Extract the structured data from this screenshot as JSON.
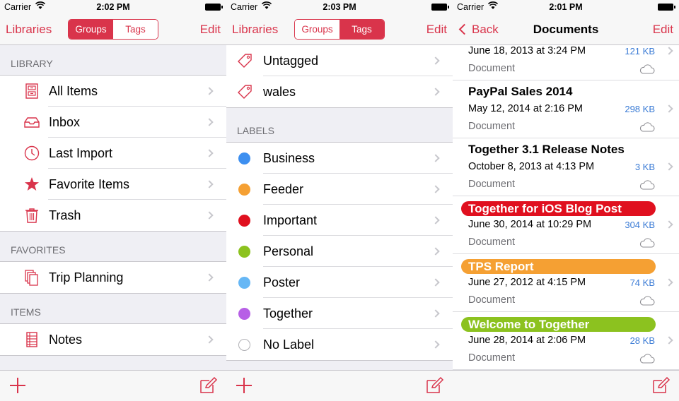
{
  "status_bars": [
    {
      "carrier": "Carrier",
      "time": "2:02 PM"
    },
    {
      "carrier": "Carrier",
      "time": "2:03 PM"
    },
    {
      "carrier": "Carrier",
      "time": "2:01 PM"
    }
  ],
  "panel1": {
    "nav_left": "Libraries",
    "segment": [
      "Groups",
      "Tags"
    ],
    "segment_active": "Groups",
    "nav_right": "Edit",
    "sections": [
      {
        "header": "LIBRARY",
        "items": [
          {
            "label": "All Items",
            "icon": "cabinet-icon"
          },
          {
            "label": "Inbox",
            "icon": "inbox-icon"
          },
          {
            "label": "Last Import",
            "icon": "clock-icon"
          },
          {
            "label": "Favorite Items",
            "icon": "star-icon"
          },
          {
            "label": "Trash",
            "icon": "trash-icon"
          }
        ]
      },
      {
        "header": "FAVORITES",
        "items": [
          {
            "label": "Trip Planning",
            "icon": "documents-icon"
          }
        ]
      },
      {
        "header": "ITEMS",
        "items": [
          {
            "label": "Notes",
            "icon": "notes-icon"
          }
        ]
      }
    ]
  },
  "panel2": {
    "nav_left": "Libraries",
    "segment": [
      "Groups",
      "Tags"
    ],
    "segment_active": "Tags",
    "nav_right": "Edit",
    "tags": [
      {
        "label": "Untagged",
        "icon": "tag-icon"
      },
      {
        "label": "wales",
        "icon": "tag-icon"
      }
    ],
    "labels_header": "LABELS",
    "labels": [
      {
        "label": "Business",
        "color": "#3d8ff0"
      },
      {
        "label": "Feeder",
        "color": "#f5a033"
      },
      {
        "label": "Important",
        "color": "#e0101f"
      },
      {
        "label": "Personal",
        "color": "#8cc21f"
      },
      {
        "label": "Poster",
        "color": "#66b7f5"
      },
      {
        "label": "Together",
        "color": "#b760e6"
      },
      {
        "label": "No Label",
        "color": "#ffffff"
      }
    ]
  },
  "panel3": {
    "nav_left": "Back",
    "title": "Documents",
    "nav_right": "Edit",
    "documents": [
      {
        "title": "",
        "date": "June 18, 2013 at 3:24 PM",
        "size": "121 KB",
        "kind": "Document",
        "label_color": ""
      },
      {
        "title": "PayPal Sales 2014",
        "date": "May 12, 2014 at 2:16 PM",
        "size": "298 KB",
        "kind": "Document",
        "label_color": ""
      },
      {
        "title": "Together 3.1 Release Notes",
        "date": "October 8, 2013 at 4:13 PM",
        "size": "3 KB",
        "kind": "Document",
        "label_color": ""
      },
      {
        "title": "Together for iOS Blog Post",
        "date": "June 30, 2014 at 10:29 PM",
        "size": "304 KB",
        "kind": "Document",
        "label_color": "#e0101f"
      },
      {
        "title": "TPS Report",
        "date": "June 27, 2012 at 4:15 PM",
        "size": "74 KB",
        "kind": "Document",
        "label_color": "#f5a033"
      },
      {
        "title": "Welcome to Together",
        "date": "June 28, 2014 at 2:06 PM",
        "size": "28 KB",
        "kind": "Document",
        "label_color": "#8cc21f"
      }
    ]
  },
  "accent_color": "#d9344b"
}
